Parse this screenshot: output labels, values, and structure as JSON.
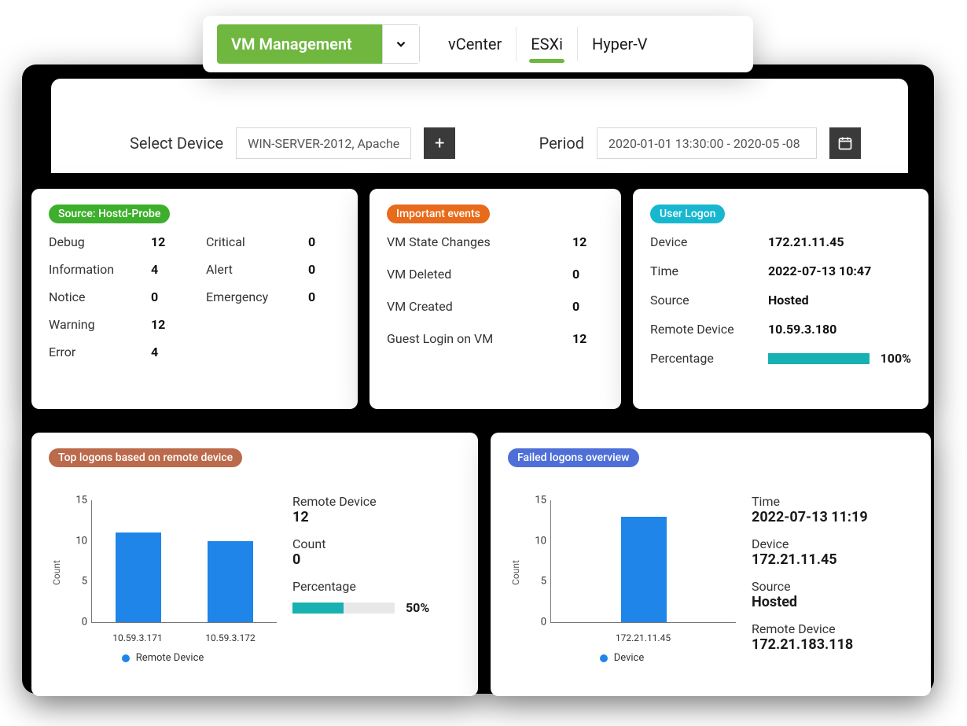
{
  "topbar": {
    "dropdown_label": "VM Management",
    "tabs": [
      "vCenter",
      "ESXi",
      "Hyper-V"
    ],
    "active_tab_index": 1
  },
  "filters": {
    "select_device_label": "Select Device",
    "select_device_value": "WIN-SERVER-2012, Apache",
    "period_label": "Period",
    "period_value": "2020-01-01 13:30:00 - 2020-05 -08"
  },
  "cards": {
    "source": {
      "title": "Source: Hostd-Probe",
      "rows": [
        {
          "l1": "Debug",
          "v1": "12",
          "l2": "Critical",
          "v2": "0"
        },
        {
          "l1": "Information",
          "v1": "4",
          "l2": "Alert",
          "v2": "0"
        },
        {
          "l1": "Notice",
          "v1": "0",
          "l2": "Emergency",
          "v2": "0"
        },
        {
          "l1": "Warning",
          "v1": "12",
          "l2": "",
          "v2": ""
        },
        {
          "l1": "Error",
          "v1": "4",
          "l2": "",
          "v2": ""
        }
      ]
    },
    "important": {
      "title": "Important events",
      "rows": [
        {
          "l": "VM State Changes",
          "v": "12"
        },
        {
          "l": "VM Deleted",
          "v": "0"
        },
        {
          "l": "VM Created",
          "v": "0"
        },
        {
          "l": "Guest Login on VM",
          "v": "12"
        }
      ]
    },
    "userlogon": {
      "title": "User Logon",
      "device_l": "Device",
      "device_v": "172.21.11.45",
      "time_l": "Time",
      "time_v": "2022-07-13 10:47",
      "source_l": "Source",
      "source_v": "Hosted",
      "remote_l": "Remote Device",
      "remote_v": "10.59.3.180",
      "pct_l": "Percentage",
      "pct_v": "100%",
      "pct_num": 100
    },
    "toplogons": {
      "title": "Top logons based on remote device",
      "side": {
        "remote_l": "Remote Device",
        "remote_v": "12",
        "count_l": "Count",
        "count_v": "0",
        "pct_l": "Percentage",
        "pct_v": "50%",
        "pct_num": 50
      }
    },
    "failed": {
      "title": "Failed logons overview",
      "side": {
        "time_l": "Time",
        "time_v": "2022-07-13 11:19",
        "device_l": "Device",
        "device_v": "172.21.11.45",
        "source_l": "Source",
        "source_v": "Hosted",
        "remote_l": "Remote Device",
        "remote_v": "172.21.183.118"
      }
    }
  },
  "chart_data": [
    {
      "id": "toplogons",
      "type": "bar",
      "title": "Top logons based on remote device",
      "categories": [
        "10.59.3.171",
        "10.59.3.172"
      ],
      "values": [
        11,
        10
      ],
      "ylabel": "Count",
      "ylim": [
        0,
        15
      ],
      "yticks": [
        0,
        5,
        10,
        15
      ],
      "legend": "Remote Device"
    },
    {
      "id": "failed",
      "type": "bar",
      "title": "Failed logons overview",
      "categories": [
        "172.21.11.45"
      ],
      "values": [
        13
      ],
      "ylabel": "Count",
      "ylim": [
        0,
        15
      ],
      "yticks": [
        0,
        5,
        10,
        15
      ],
      "legend": "Device"
    }
  ]
}
